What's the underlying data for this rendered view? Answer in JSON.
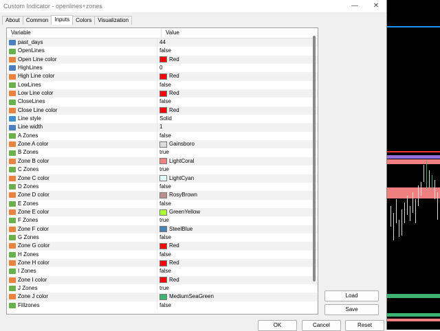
{
  "window": {
    "title": "Custom Indicator - openlines+zones",
    "minimize": "—",
    "close": "✕"
  },
  "tabs": [
    "About",
    "Common",
    "Inputs",
    "Colors",
    "Visualization"
  ],
  "grid": {
    "col_variable": "Variable",
    "col_value": "Value",
    "rows": [
      {
        "name": "past_days",
        "value": "44",
        "type": "num"
      },
      {
        "name": "OpenLines",
        "value": "false",
        "type": "bool"
      },
      {
        "name": "Open Line color",
        "value": "Red",
        "type": "col",
        "color": "#ff0000"
      },
      {
        "name": "HighLines",
        "value": "0",
        "type": "num"
      },
      {
        "name": "High Line color",
        "value": "Red",
        "type": "col",
        "color": "#ff0000"
      },
      {
        "name": "LowLines",
        "value": "false",
        "type": "bool"
      },
      {
        "name": "Low Line color",
        "value": "Red",
        "type": "col",
        "color": "#ff0000"
      },
      {
        "name": "CloseLines",
        "value": "false",
        "type": "bool"
      },
      {
        "name": "Close Line color",
        "value": "Red",
        "type": "col",
        "color": "#ff0000"
      },
      {
        "name": "Line style",
        "value": "Solid",
        "type": "sty"
      },
      {
        "name": "Line width",
        "value": "1",
        "type": "num"
      },
      {
        "name": "A Zones",
        "value": "false",
        "type": "bool"
      },
      {
        "name": "Zone A color",
        "value": "Gainsboro",
        "type": "col",
        "color": "#dcdcdc"
      },
      {
        "name": "B Zones",
        "value": "true",
        "type": "bool"
      },
      {
        "name": "Zone B color",
        "value": "LightCoral",
        "type": "col",
        "color": "#f08080"
      },
      {
        "name": "C Zones",
        "value": "true",
        "type": "bool"
      },
      {
        "name": "Zone C color",
        "value": "LightCyan",
        "type": "col",
        "color": "#e0ffff"
      },
      {
        "name": "D Zones",
        "value": "false",
        "type": "bool"
      },
      {
        "name": "Zone D color",
        "value": "RosyBrown",
        "type": "col",
        "color": "#bc8f8f"
      },
      {
        "name": "E Zones",
        "value": "false",
        "type": "bool"
      },
      {
        "name": "Zone E color",
        "value": "GreenYellow",
        "type": "col",
        "color": "#adff2f"
      },
      {
        "name": "F Zones",
        "value": "true",
        "type": "bool"
      },
      {
        "name": "Zone F color",
        "value": "SteelBlue",
        "type": "col",
        "color": "#4682b4"
      },
      {
        "name": "G Zones",
        "value": "false",
        "type": "bool"
      },
      {
        "name": "Zone G color",
        "value": "Red",
        "type": "col",
        "color": "#ff0000"
      },
      {
        "name": "H Zones",
        "value": "false",
        "type": "bool"
      },
      {
        "name": "Zone H color",
        "value": "Red",
        "type": "col",
        "color": "#ff0000"
      },
      {
        "name": "I Zones",
        "value": "false",
        "type": "bool"
      },
      {
        "name": "Zone I color",
        "value": "Red",
        "type": "col",
        "color": "#ff0000"
      },
      {
        "name": "J Zones",
        "value": "true",
        "type": "bool"
      },
      {
        "name": "Zone J color",
        "value": "MediumSeaGreen",
        "type": "col",
        "color": "#3cb371"
      },
      {
        "name": "Fillzones",
        "value": "false",
        "type": "bool"
      }
    ]
  },
  "buttons": {
    "load": "Load",
    "save": "Save",
    "ok": "OK",
    "cancel": "Cancel",
    "reset": "Reset"
  },
  "chart_colors": {
    "background": "#000000",
    "blue_line": "#1e90ff",
    "purple": "#9370db",
    "coral": "#f08080",
    "red": "#ff0000",
    "green": "#3cb371",
    "white": "#ffffff"
  }
}
